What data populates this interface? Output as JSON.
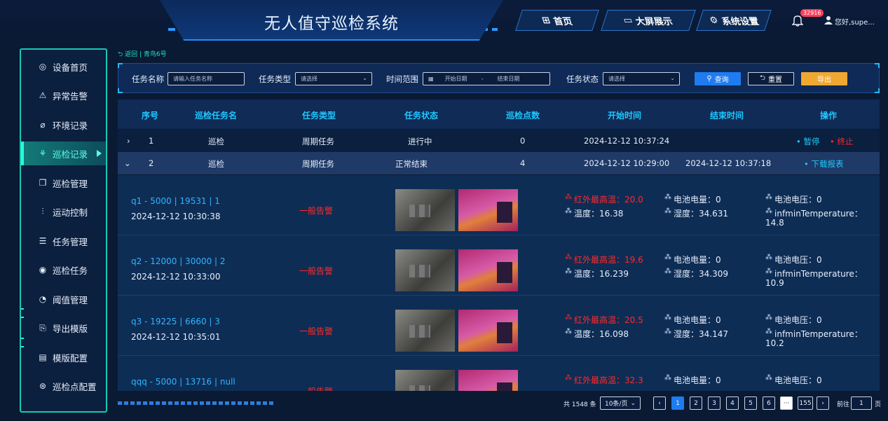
{
  "header": {
    "title": "无人值守巡检系统",
    "nav": [
      {
        "label": "首页",
        "icon": "grid-icon"
      },
      {
        "label": "大屏展示",
        "icon": "monitor-icon"
      },
      {
        "label": "系统设置",
        "icon": "gear-icon"
      }
    ],
    "notification_count": "32916",
    "user_greeting": "您好,supe..."
  },
  "sidebar": {
    "items": [
      {
        "label": "设备首页"
      },
      {
        "label": "异常告警"
      },
      {
        "label": "环境记录"
      },
      {
        "label": "巡检记录"
      },
      {
        "label": "巡检管理"
      },
      {
        "label": "运动控制"
      },
      {
        "label": "任务管理"
      },
      {
        "label": "巡检任务"
      },
      {
        "label": "阈值管理"
      },
      {
        "label": "导出模版"
      },
      {
        "label": "模版配置"
      },
      {
        "label": "巡检点配置"
      }
    ],
    "active_index": 3
  },
  "breadcrumb": "返回 | 青鸟6号",
  "filter": {
    "task_name_label": "任务名称",
    "task_name_placeholder": "请输入任务名称",
    "task_type_label": "任务类型",
    "task_type_value": "请选择",
    "time_range_label": "时间范围",
    "start_placeholder": "开始日期",
    "range_sep": "-",
    "end_placeholder": "结束日期",
    "task_status_label": "任务状态",
    "task_status_value": "请选择",
    "search_label": "查询",
    "reset_label": "重置",
    "export_label": "导出"
  },
  "table": {
    "headers": [
      "序号",
      "巡检任务名",
      "任务类型",
      "任务状态",
      "巡检点数",
      "开始时间",
      "结束时间",
      "操作"
    ],
    "rows": [
      {
        "index": "1",
        "name": "巡检",
        "type": "周期任务",
        "status": "进行中",
        "points": "0",
        "start": "2024-12-12 10:37:24",
        "end": "",
        "actions": [
          "暂停",
          "终止"
        ]
      },
      {
        "index": "2",
        "name": "巡检",
        "type": "周期任务",
        "status": "正常结束",
        "points": "4",
        "start": "2024-12-12 10:29:00",
        "end": "2024-12-12 10:37:18",
        "actions": [
          "下载报表"
        ]
      }
    ]
  },
  "details": [
    {
      "title": "q1 - 5000 | 19531 | 1",
      "time": "2024-12-12 10:30:38",
      "alarm": "一般告警",
      "ir_max": "红外最高温：20.0",
      "temp": "温度：16.38",
      "battery_level": "电池电量：0",
      "humidity": "湿度：34.631",
      "battery_voltage": "电池电压：0",
      "inf_min": "infminTemperature：",
      "inf_min_val": "14.8"
    },
    {
      "title": "q2 - 12000 | 30000 | 2",
      "time": "2024-12-12 10:33:00",
      "alarm": "一般告警",
      "ir_max": "红外最高温：19.6",
      "temp": "温度：16.239",
      "battery_level": "电池电量：0",
      "humidity": "湿度：34.309",
      "battery_voltage": "电池电压：0",
      "inf_min": "infminTemperature：",
      "inf_min_val": "10.9"
    },
    {
      "title": "q3 - 19225 | 6660 | 3",
      "time": "2024-12-12 10:35:01",
      "alarm": "一般告警",
      "ir_max": "红外最高温：20.5",
      "temp": "温度：16.098",
      "battery_level": "电池电量：0",
      "humidity": "湿度：34.147",
      "battery_voltage": "电池电压：0",
      "inf_min": "infminTemperature：",
      "inf_min_val": "10.2"
    },
    {
      "title": "qqq - 5000 | 13716 | null",
      "time": "",
      "alarm": "一般告警",
      "ir_max": "红外最高温：32.3",
      "temp": "",
      "battery_level": "电池电量：0",
      "humidity": "",
      "battery_voltage": "电池电压：0",
      "inf_min": "",
      "inf_min_val": ""
    }
  ],
  "pagination": {
    "total": "共 1548 条",
    "page_size": "10条/页",
    "pages": [
      "1",
      "2",
      "3",
      "4",
      "5",
      "6"
    ],
    "ellipsis": "···",
    "last": "155",
    "goto_label": "前往",
    "goto_value": "1",
    "page_suffix": "页",
    "prev": "‹",
    "next": "›"
  },
  "colors": {
    "accent": "#1ec8ff",
    "active": "#25ffd8",
    "alarm": "#ff2a2a",
    "primary_btn": "#1e7cf0",
    "export_btn": "#f0a830"
  }
}
